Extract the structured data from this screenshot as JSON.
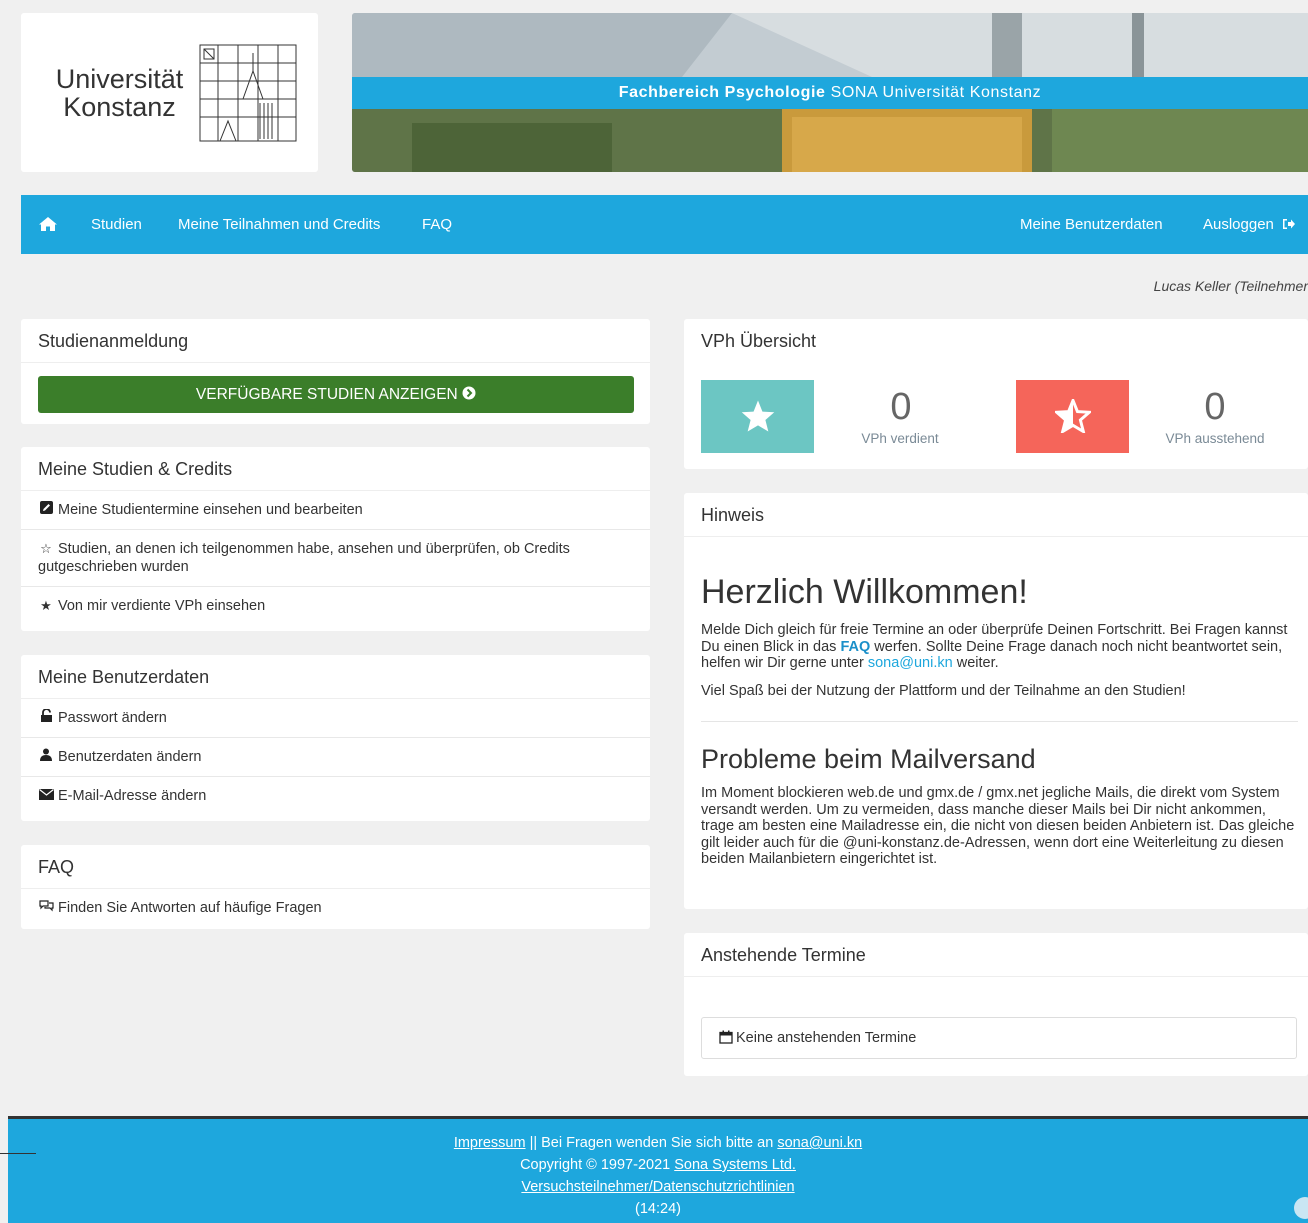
{
  "logo": {
    "line1": "Universität",
    "line2": "Konstanz"
  },
  "banner": {
    "bold": "Fachbereich Psychologie",
    "rest": " SONA Universität Konstanz"
  },
  "nav": {
    "home_icon": "home-icon",
    "studien": "Studien",
    "teilnahmen": "Meine Teilnahmen und Credits",
    "faq": "FAQ",
    "benutzerdaten": "Meine Benutzerdaten",
    "logout": "Ausloggen",
    "logout_icon": "logout-icon"
  },
  "user": {
    "display": "Lucas Keller (Teilnehmer"
  },
  "studienanmeldung": {
    "title": "Studienanmeldung",
    "button": "VERFÜGBARE STUDIEN ANZEIGEN"
  },
  "meine_studien": {
    "title": "Meine Studien & Credits",
    "items": [
      {
        "icon": "edit-icon",
        "label": "Meine Studientermine einsehen und bearbeiten"
      },
      {
        "icon": "star-half-icon",
        "label": "Studien, an denen ich teilgenommen habe, ansehen und überprüfen, ob Credits gutgeschrieben wurden"
      },
      {
        "icon": "star-icon",
        "label": "Von mir verdiente VPh einsehen"
      }
    ]
  },
  "benutzerdaten": {
    "title": "Meine Benutzerdaten",
    "items": [
      {
        "icon": "unlock-icon",
        "label": "Passwort ändern"
      },
      {
        "icon": "user-icon",
        "label": "Benutzerdaten ändern"
      },
      {
        "icon": "envelope-icon",
        "label": "E-Mail-Adresse ändern"
      }
    ]
  },
  "faq_panel": {
    "title": "FAQ",
    "items": [
      {
        "icon": "comments-icon",
        "label": "Finden Sie Antworten auf häufige Fragen"
      }
    ]
  },
  "vph": {
    "title": "VPh Übersicht",
    "earned": {
      "value": "0",
      "label": "VPh verdient",
      "color": "#6cc6c3"
    },
    "pending": {
      "value": "0",
      "label": "VPh ausstehend",
      "color": "#f5655a"
    }
  },
  "hinweis": {
    "title": "Hinweis",
    "welcome": "Herzlich Willkommen!",
    "p1_a": "Melde Dich gleich für freie Termine an oder überprüfe Deinen Fortschritt. Bei Fragen kannst Du einen Blick in das ",
    "p1_faq": "FAQ",
    "p1_b": " werfen. Sollte Deine Frage danach noch nicht beantwortet sein, helfen wir Dir gerne unter ",
    "p1_mail": "sona@uni.kn",
    "p1_c": " weiter.",
    "p2": "Viel Spaß bei der Nutzung der Plattform und der Teilnahme an den Studien!",
    "problem_title": "Probleme beim Mailversand",
    "p3": "Im Moment blockieren web.de und gmx.de / gmx.net jegliche Mails, die direkt vom System versandt werden. Um zu vermeiden, dass manche dieser Mails bei Dir nicht ankommen, trage am besten eine Mailadresse ein, die nicht von diesen beiden Anbietern ist. Das gleiche gilt leider auch für die @uni-konstanz.de-Adressen, wenn dort eine Weiterleitung zu diesen beiden Mailanbietern eingerichtet ist."
  },
  "termine": {
    "title": "Anstehende Termine",
    "empty": "Keine anstehenden Termine"
  },
  "footer": {
    "impressum": "Impressum",
    "fragen": " || Bei Fragen wenden Sie sich bitte an ",
    "mail": "sona@uni.kn",
    "copyright": "Copyright © 1997-2021 ",
    "sona": "Sona Systems Ltd.",
    "datenschutz": "Versuchsteilnehmer/Datenschutzrichtlinien",
    "time": "(14:24)"
  },
  "colors": {
    "brand": "#1ea7dd",
    "green": "#3b7e2a"
  }
}
